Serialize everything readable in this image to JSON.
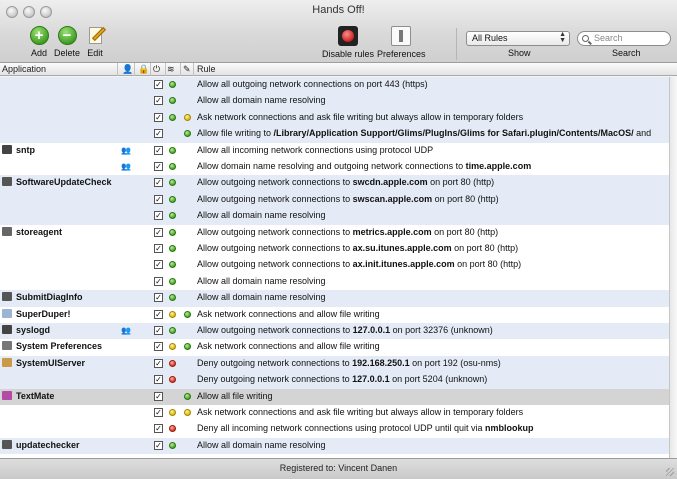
{
  "window": {
    "title": "Hands Off!"
  },
  "toolbar": {
    "add_label": "Add",
    "add_glyph": "+",
    "delete_label": "Delete",
    "delete_glyph": "−",
    "edit_label": "Edit",
    "disable_rules_label": "Disable rules",
    "preferences_label": "Preferences",
    "show_select_value": "All Rules",
    "show_label": "Show",
    "search_placeholder": "Search",
    "search_label": "Search"
  },
  "columns": {
    "application": "Application",
    "rule": "Rule"
  },
  "header_icons": [
    "user-icon",
    "lock-icon",
    "power-icon",
    "wifi-icon",
    "pencil-icon"
  ],
  "rows": [
    {
      "app": "",
      "grp": false,
      "checked": true,
      "d1": "green",
      "d2": "",
      "parts": [
        {
          "t": "Allow all outgoing network connections on port 443 (https)"
        }
      ],
      "bg": "alt"
    },
    {
      "app": "",
      "grp": false,
      "checked": true,
      "d1": "green",
      "d2": "",
      "parts": [
        {
          "t": "Allow all domain name resolving"
        }
      ],
      "bg": "alt"
    },
    {
      "app": "",
      "grp": false,
      "checked": true,
      "d1": "green",
      "d2": "yellow",
      "parts": [
        {
          "t": "Ask network connections and ask file writing but always allow in temporary folders"
        }
      ],
      "bg": "alt"
    },
    {
      "app": "",
      "grp": false,
      "checked": true,
      "d1": "",
      "d2": "green",
      "parts": [
        {
          "t": "Allow file writing to "
        },
        {
          "t": "/Library/Application Support/Glims/PlugIns/Glims for Safari.plugin/Contents/MacOS/",
          "b": true
        },
        {
          "t": " and"
        }
      ],
      "bg": "alt"
    },
    {
      "app": "sntp",
      "grp": true,
      "checked": true,
      "d1": "green",
      "d2": "",
      "parts": [
        {
          "t": "Allow all incoming network connections using protocol UDP"
        }
      ],
      "bg": "white"
    },
    {
      "app": "",
      "grp": true,
      "checked": true,
      "d1": "green",
      "d2": "",
      "parts": [
        {
          "t": "Allow domain name resolving and outgoing network connections to "
        },
        {
          "t": "time.apple.com",
          "b": true
        }
      ],
      "bg": "white"
    },
    {
      "app": "SoftwareUpdateCheck",
      "grp": false,
      "checked": true,
      "d1": "green",
      "d2": "",
      "parts": [
        {
          "t": "Allow outgoing network connections to "
        },
        {
          "t": "swcdn.apple.com",
          "b": true
        },
        {
          "t": " on port 80 (http)"
        }
      ],
      "bg": "alt"
    },
    {
      "app": "",
      "grp": false,
      "checked": true,
      "d1": "green",
      "d2": "",
      "parts": [
        {
          "t": "Allow outgoing network connections to "
        },
        {
          "t": "swscan.apple.com",
          "b": true
        },
        {
          "t": " on port 80 (http)"
        }
      ],
      "bg": "alt"
    },
    {
      "app": "",
      "grp": false,
      "checked": true,
      "d1": "green",
      "d2": "",
      "parts": [
        {
          "t": "Allow all domain name resolving"
        }
      ],
      "bg": "alt"
    },
    {
      "app": "storeagent",
      "grp": false,
      "checked": true,
      "d1": "green",
      "d2": "",
      "parts": [
        {
          "t": "Allow outgoing network connections to "
        },
        {
          "t": "metrics.apple.com",
          "b": true
        },
        {
          "t": " on port 80 (http)"
        }
      ],
      "bg": "white"
    },
    {
      "app": "",
      "grp": false,
      "checked": true,
      "d1": "green",
      "d2": "",
      "parts": [
        {
          "t": "Allow outgoing network connections to "
        },
        {
          "t": "ax.su.itunes.apple.com",
          "b": true
        },
        {
          "t": " on port 80 (http)"
        }
      ],
      "bg": "white"
    },
    {
      "app": "",
      "grp": false,
      "checked": true,
      "d1": "green",
      "d2": "",
      "parts": [
        {
          "t": "Allow outgoing network connections to "
        },
        {
          "t": "ax.init.itunes.apple.com",
          "b": true
        },
        {
          "t": " on port 80 (http)"
        }
      ],
      "bg": "white"
    },
    {
      "app": "",
      "grp": false,
      "checked": true,
      "d1": "green",
      "d2": "",
      "parts": [
        {
          "t": "Allow all domain name resolving"
        }
      ],
      "bg": "white"
    },
    {
      "app": "SubmitDiagInfo",
      "grp": false,
      "checked": true,
      "d1": "green",
      "d2": "",
      "parts": [
        {
          "t": "Allow all domain name resolving"
        }
      ],
      "bg": "alt"
    },
    {
      "app": "SuperDuper!",
      "grp": false,
      "checked": true,
      "d1": "yellow",
      "d2": "green",
      "parts": [
        {
          "t": "Ask network connections and allow file writing"
        }
      ],
      "bg": "white"
    },
    {
      "app": "syslogd",
      "grp": true,
      "checked": true,
      "d1": "green",
      "d2": "",
      "parts": [
        {
          "t": "Allow outgoing network connections to "
        },
        {
          "t": "127.0.0.1",
          "b": true
        },
        {
          "t": " on port 32376 (unknown)"
        }
      ],
      "bg": "alt"
    },
    {
      "app": "System Preferences",
      "grp": false,
      "checked": true,
      "d1": "yellow",
      "d2": "green",
      "parts": [
        {
          "t": "Ask network connections and allow file writing"
        }
      ],
      "bg": "white"
    },
    {
      "app": "SystemUIServer",
      "grp": false,
      "checked": true,
      "d1": "red",
      "d2": "",
      "parts": [
        {
          "t": "Deny outgoing network connections to "
        },
        {
          "t": "192.168.250.1",
          "b": true
        },
        {
          "t": " on port 192 (osu-nms)"
        }
      ],
      "bg": "alt"
    },
    {
      "app": "",
      "grp": false,
      "checked": true,
      "d1": "red",
      "d2": "",
      "parts": [
        {
          "t": "Deny outgoing network connections to "
        },
        {
          "t": "127.0.0.1",
          "b": true
        },
        {
          "t": " on port 5204 (unknown)"
        }
      ],
      "bg": "alt"
    },
    {
      "app": "TextMate",
      "grp": false,
      "checked": true,
      "d1": "",
      "d2": "green",
      "parts": [
        {
          "t": "Allow all file writing"
        }
      ],
      "bg": "sel"
    },
    {
      "app": "",
      "grp": false,
      "checked": true,
      "d1": "yellow",
      "d2": "yellow",
      "parts": [
        {
          "t": "Ask network connections and ask file writing but always allow in temporary folders"
        }
      ],
      "bg": "white"
    },
    {
      "app": "",
      "grp": false,
      "checked": true,
      "d1": "red",
      "d2": "",
      "parts": [
        {
          "t": "Deny all incoming network connections using protocol UDP until quit via "
        },
        {
          "t": "nmblookup",
          "b": true
        }
      ],
      "bg": "white"
    },
    {
      "app": "updatechecker",
      "grp": false,
      "checked": true,
      "d1": "green",
      "d2": "",
      "parts": [
        {
          "t": "Allow all domain name resolving"
        }
      ],
      "bg": "alt"
    }
  ],
  "status": {
    "text": "Registered to: Vincent Danen"
  },
  "colors": {
    "alt_row": "#e4ebf6",
    "selected_row": "#d4d4d4",
    "gray_block": "#eeeeee"
  }
}
